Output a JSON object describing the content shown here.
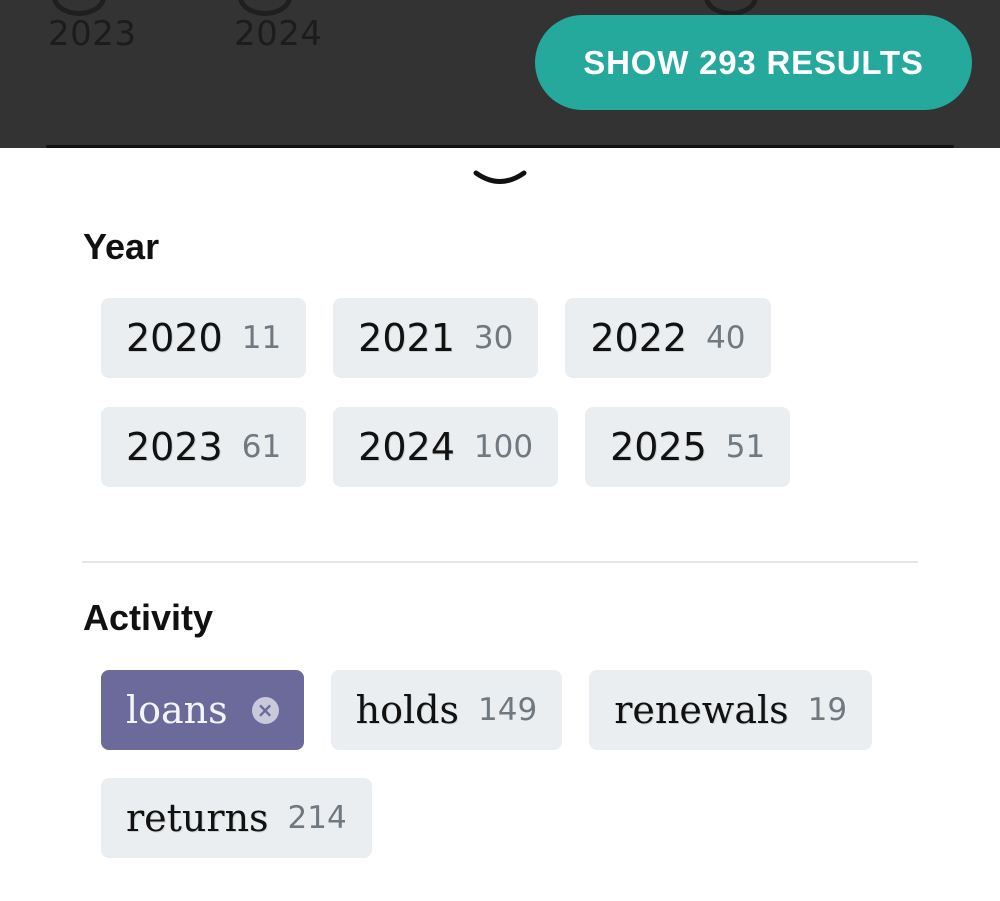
{
  "timeline": {
    "labels": [
      "2023",
      "2024"
    ]
  },
  "results_button": {
    "label": "SHOW 293 RESULTS"
  },
  "filters": {
    "year": {
      "title": "Year",
      "chips": [
        {
          "label": "2020",
          "count": "11"
        },
        {
          "label": "2021",
          "count": "30"
        },
        {
          "label": "2022",
          "count": "40"
        },
        {
          "label": "2023",
          "count": "61"
        },
        {
          "label": "2024",
          "count": "100"
        },
        {
          "label": "2025",
          "count": "51"
        }
      ]
    },
    "activity": {
      "title": "Activity",
      "chips": [
        {
          "label": "loans",
          "selected": true,
          "clear_icon": "×"
        },
        {
          "label": "holds",
          "count": "149"
        },
        {
          "label": "renewals",
          "count": "19"
        },
        {
          "label": "returns",
          "count": "214"
        }
      ]
    }
  },
  "colors": {
    "header_bg": "#333333",
    "accent_teal": "#25a99d",
    "chip_bg": "#ebeef0",
    "chip_selected_bg": "#6b6a9b",
    "count_text": "#707880"
  },
  "icons": {
    "collapse": "chevron-down-icon",
    "clear": "close-icon"
  }
}
